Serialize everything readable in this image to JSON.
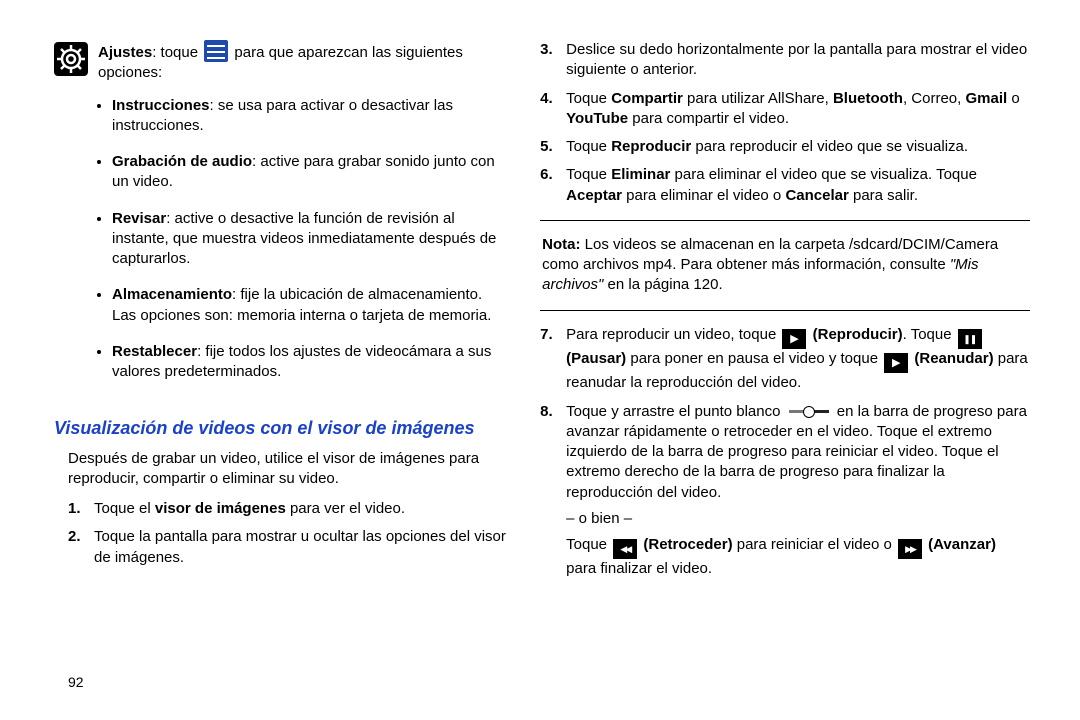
{
  "left": {
    "ajustes_bold": "Ajustes",
    "ajustes_after": ": toque ",
    "ajustes_tail": " para que aparezcan las siguientes opciones:",
    "bullets": [
      {
        "b": "Instrucciones",
        "rest": ": se usa para activar o desactivar las instrucciones."
      },
      {
        "b": "Grabación de audio",
        "rest": ": active para grabar sonido junto con un video."
      },
      {
        "b": "Revisar",
        "rest": ": active o desactive la función de revisión al instante, que muestra videos inmediatamente después de capturarlos."
      },
      {
        "b": "Almacenamiento",
        "rest": ": fije la ubicación de almacenamiento. Las opciones son: memoria interna o tarjeta de memoria."
      },
      {
        "b": "Restablecer",
        "rest": ": fije todos los ajustes de videocámara a sus valores predeterminados."
      }
    ],
    "section_title": "Visualización de videos con el visor de imágenes",
    "intro": "Después de grabar un video, utilice el visor de imágenes para reproducir, compartir o eliminar su video.",
    "steps": [
      {
        "n": "1.",
        "pre": "Toque el ",
        "b": "visor de imágenes",
        "post": " para ver el video."
      },
      {
        "n": "2.",
        "text": "Toque la pantalla para mostrar u ocultar las opciones del visor de imágenes."
      }
    ],
    "page_num": "92"
  },
  "right": {
    "steps_a": [
      {
        "n": "3.",
        "text": "Deslice su dedo horizontalmente por la pantalla para mostrar el video siguiente o anterior."
      },
      {
        "n": "4.",
        "pre": "Toque ",
        "b1": "Compartir",
        "mid": " para utilizar AllShare, ",
        "b2": "Bluetooth",
        "mid2": ", Correo, ",
        "b3": "Gmail",
        "mid3": " o ",
        "b4": "YouTube",
        "post": " para compartir el video."
      },
      {
        "n": "5.",
        "pre": "Toque ",
        "b": "Reproducir",
        "post": " para reproducir el video que se visualiza."
      },
      {
        "n": "6.",
        "pre": "Toque ",
        "b1": "Eliminar",
        "mid": " para eliminar el video que se visualiza. Toque ",
        "b2": "Aceptar",
        "mid2": " para eliminar el video o ",
        "b3": "Cancelar",
        "post": " para salir."
      }
    ],
    "nota_b": "Nota:",
    "nota_text": " Los videos se almacenan en la carpeta /sdcard/DCIM/Camera como archivos mp4. Para obtener más información, consulte ",
    "nota_i": "\"Mis archivos\"",
    "nota_tail": " en la página 120.",
    "steps_b": [
      {
        "n": "7.",
        "pre": "Para reproducir un video, toque ",
        "b1": "(Reproducir)",
        "mid": ". Toque ",
        "b2": "(Pausar)",
        "mid2": " para poner en pausa el video y toque ",
        "b3": "(Reanudar)",
        "post": " para reanudar la reproducción del video."
      },
      {
        "n": "8.",
        "pre": "Toque y arrastre el punto blanco ",
        "mid": " en la barra de progreso para avanzar rápidamente o retroceder en el video. Toque el extremo izquierdo de la barra de progreso para reiniciar el video. Toque el extremo derecho de la barra de progreso para finalizar la reproducción del video.",
        "obien": "– o bien –",
        "line2_pre": "Toque ",
        "b_retro": "(Retroceder)",
        "line2_mid": " para reiniciar el video o ",
        "b_avan": "(Avanzar)",
        "line2_post": " para finalizar el video."
      }
    ]
  }
}
